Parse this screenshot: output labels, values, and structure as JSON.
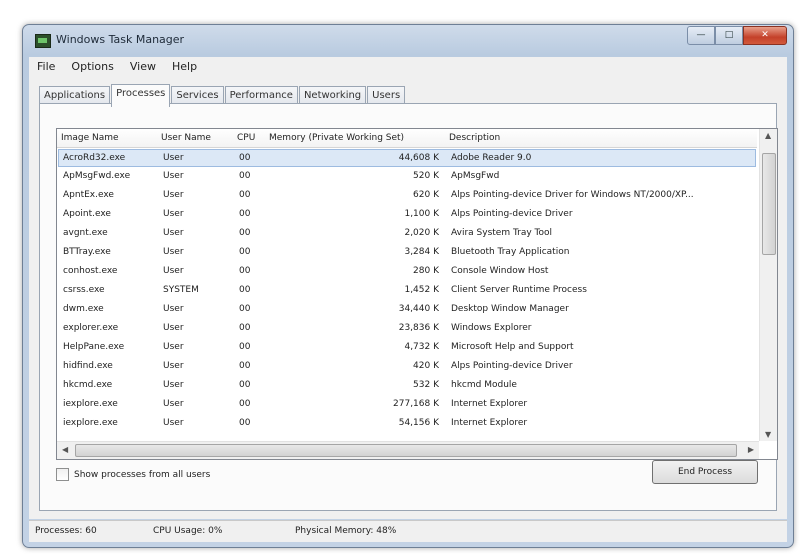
{
  "window": {
    "title": "Windows Task Manager",
    "controls": [
      "—",
      "□",
      "✕"
    ]
  },
  "menu": [
    "File",
    "Options",
    "View",
    "Help"
  ],
  "tabs": [
    "Applications",
    "Processes",
    "Services",
    "Performance",
    "Networking",
    "Users"
  ],
  "active_tab": "Processes",
  "columns": [
    "Image Name",
    "User Name",
    "CPU",
    "Memory (Private Working Set)",
    "Description"
  ],
  "rows": [
    [
      "AcroRd32.exe",
      "User",
      "00",
      "44,608 K",
      "Adobe Reader 9.0"
    ],
    [
      "ApMsgFwd.exe",
      "User",
      "00",
      "520 K",
      "ApMsgFwd"
    ],
    [
      "ApntEx.exe",
      "User",
      "00",
      "620 K",
      "Alps Pointing-device Driver for Windows NT/2000/XP..."
    ],
    [
      "Apoint.exe",
      "User",
      "00",
      "1,100 K",
      "Alps Pointing-device Driver"
    ],
    [
      "avgnt.exe",
      "User",
      "00",
      "2,020 K",
      "Avira System Tray Tool"
    ],
    [
      "BTTray.exe",
      "User",
      "00",
      "3,284 K",
      "Bluetooth Tray Application"
    ],
    [
      "conhost.exe",
      "User",
      "00",
      "280 K",
      "Console Window Host"
    ],
    [
      "csrss.exe",
      "SYSTEM",
      "00",
      "1,452 K",
      "Client Server Runtime Process"
    ],
    [
      "dwm.exe",
      "User",
      "00",
      "34,440 K",
      "Desktop Window Manager"
    ],
    [
      "explorer.exe",
      "User",
      "00",
      "23,836 K",
      "Windows Explorer"
    ],
    [
      "HelpPane.exe",
      "User",
      "00",
      "4,732 K",
      "Microsoft Help and Support"
    ],
    [
      "hidfind.exe",
      "User",
      "00",
      "420 K",
      "Alps Pointing-device Driver"
    ],
    [
      "hkcmd.exe",
      "User",
      "00",
      "532 K",
      "hkcmd Module"
    ],
    [
      "iexplore.exe",
      "User",
      "00",
      "277,168 K",
      "Internet Explorer"
    ],
    [
      "iexplore.exe",
      "User",
      "00",
      "54,156 K",
      "Internet Explorer"
    ]
  ],
  "selected_row": 0,
  "show_all_label": "Show processes from all users",
  "end_process_label": "End Process",
  "status": {
    "processes": "Processes: 60",
    "cpu": "CPU Usage: 0%",
    "memory": "Physical Memory: 48%"
  }
}
